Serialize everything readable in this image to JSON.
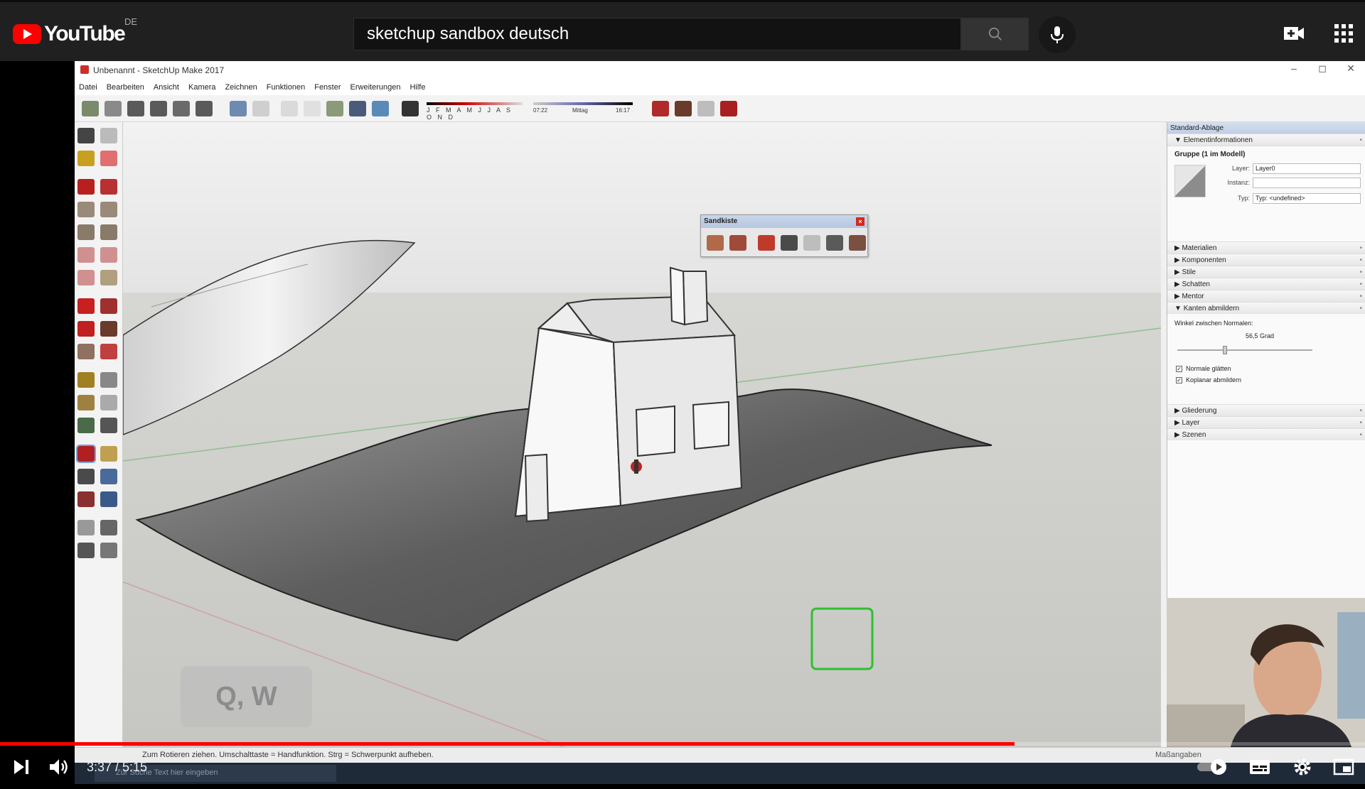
{
  "masthead": {
    "logo_text": "YouTube",
    "country_code": "DE",
    "search_value": "sketchup sandbox deutsch"
  },
  "sketchup": {
    "window_title": "Unbenannt - SketchUp Make 2017",
    "menu": [
      "Datei",
      "Bearbeiten",
      "Ansicht",
      "Kamera",
      "Zeichnen",
      "Funktionen",
      "Fenster",
      "Erweiterungen",
      "Hilfe"
    ],
    "shadow_months": "J F M A M J J A S O N D",
    "time_start": "07:22",
    "time_mid": "Mittag",
    "time_end": "16:17",
    "sandbox_toolbar_title": "Sandkiste",
    "status_hint": "Zum Rotieren ziehen. Umschalttaste = Handfunktion. Strg = Schwerpunkt aufheben.",
    "measurements_label": "Maßangaben"
  },
  "tray": {
    "title": "Standard-Ablage",
    "entity_section": "Elementinformationen",
    "group_title": "Gruppe (1 im Modell)",
    "layer_label": "Layer:",
    "layer_value": "Layer0",
    "instance_label": "Instanz:",
    "instance_value": "",
    "type_label": "Typ:",
    "type_value": "Typ: <undefined>",
    "sections_top": [
      "Materialien",
      "Komponenten",
      "Stile",
      "Schatten",
      "Mentor"
    ],
    "soften_section": "Kanten abmildern",
    "angle_label": "Winkel zwischen Normalen:",
    "angle_value": "56,5  Grad",
    "smooth_normals": "Normale glätten",
    "soften_coplanar": "Koplanar abmildern",
    "sections_bottom": [
      "Gliederung",
      "Layer",
      "Szenen"
    ]
  },
  "taskbar": {
    "search_placeholder": "Zur Suche Text hier eingeben"
  },
  "overlay": {
    "keys": "Q, W"
  },
  "player": {
    "current_time": "3:37",
    "duration": "5:15",
    "time_display": "3:37 / 5:15",
    "progress_fraction": 0.743,
    "accent_color": "#ff0000"
  }
}
